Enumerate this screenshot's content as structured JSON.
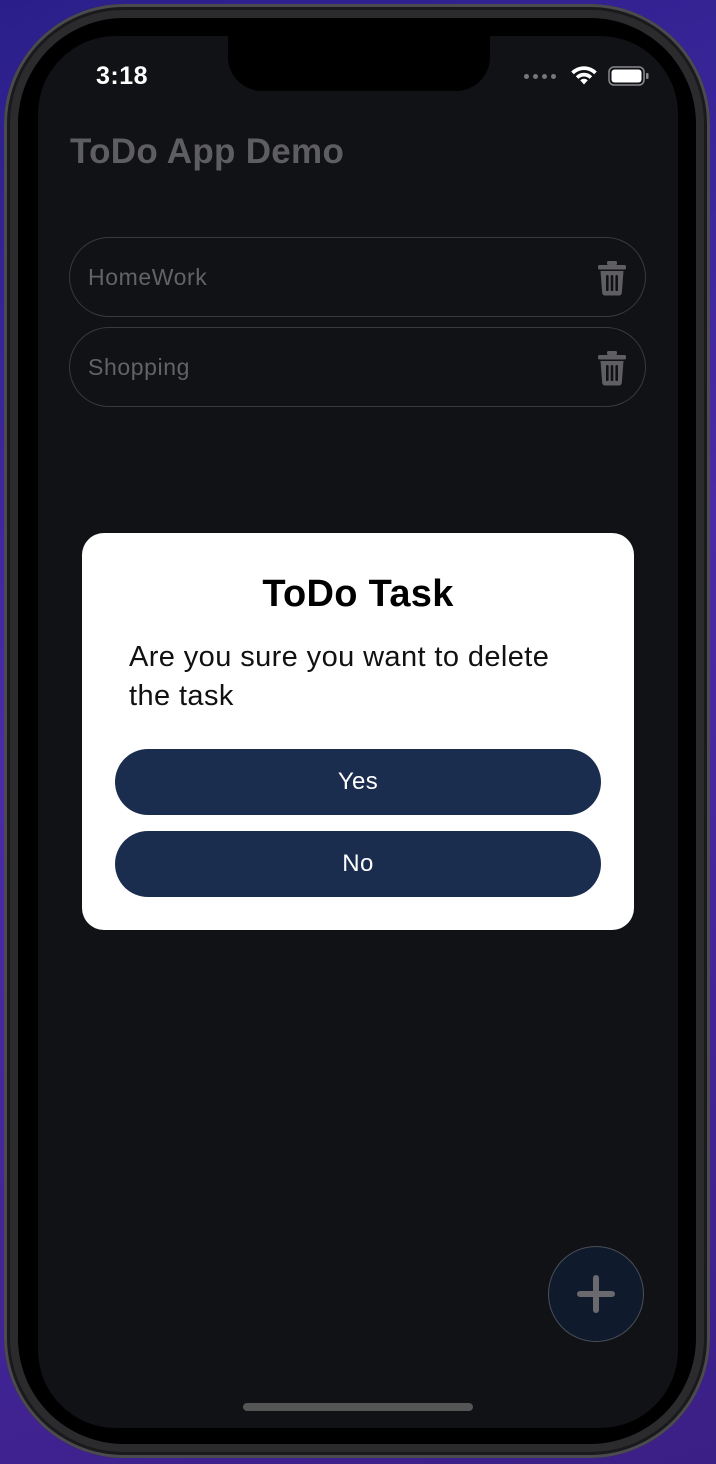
{
  "status_bar": {
    "time": "3:18"
  },
  "app": {
    "title": "ToDo App Demo",
    "tasks": [
      {
        "label": "HomeWork"
      },
      {
        "label": "Shopping"
      }
    ]
  },
  "dialog": {
    "title": "ToDo Task",
    "message": "Are you sure you want to delete the task",
    "yes_label": "Yes",
    "no_label": "No"
  },
  "colors": {
    "background": "#111215",
    "button": "#1b2d4f",
    "dialog": "#ffffff"
  },
  "icons": {
    "task_action": "trash-icon",
    "fab": "plus-icon"
  }
}
